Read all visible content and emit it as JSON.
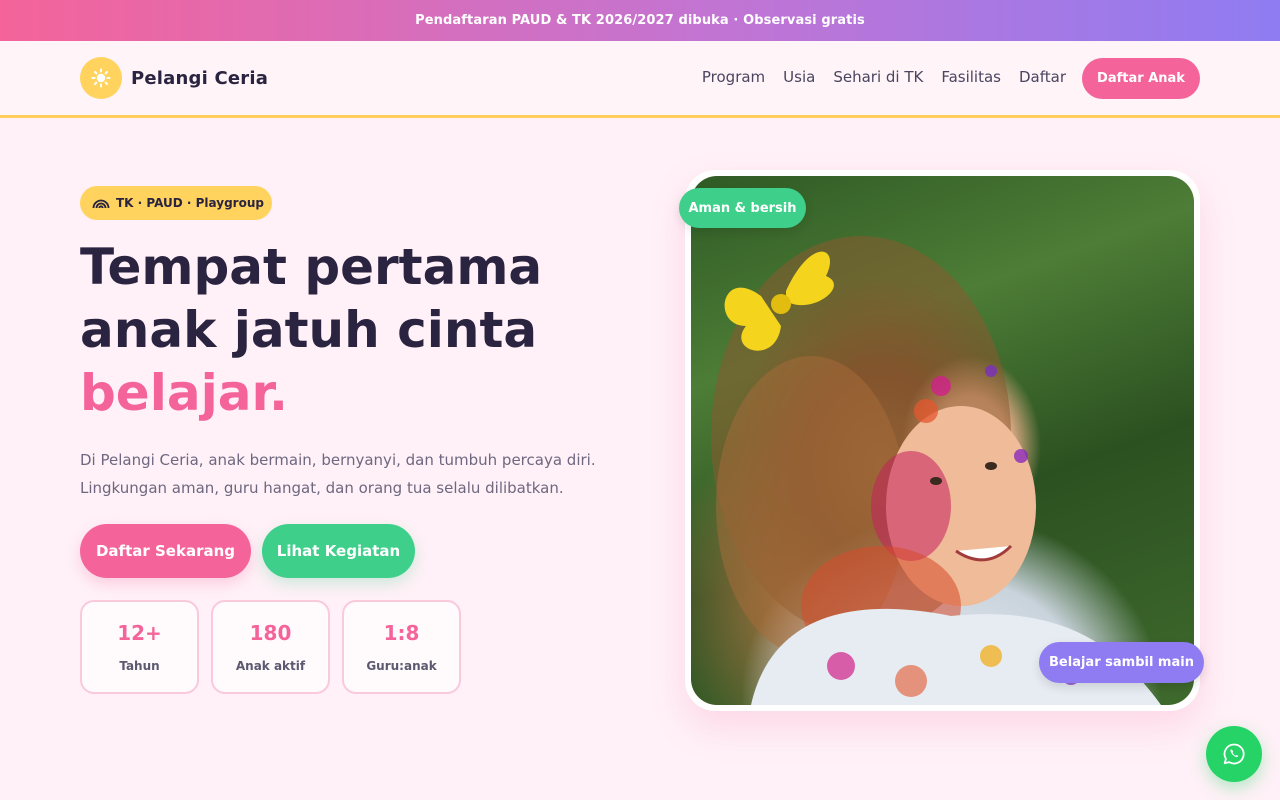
{
  "announcement": {
    "text": "Pendaftaran PAUD & TK 2026/2027 dibuka · Observasi gratis"
  },
  "brand": {
    "name": "Pelangi Ceria",
    "icon": "sun-icon"
  },
  "nav": {
    "links": [
      "Program",
      "Usia",
      "Sehari di TK",
      "Fasilitas",
      "Daftar"
    ],
    "cta_label": "Daftar Anak"
  },
  "hero": {
    "tag": "TK · PAUD · Playgroup",
    "tag_icon": "rainbow-icon",
    "headline_line1": "Tempat pertama",
    "headline_line2": "anak jatuh cinta",
    "headline_accent": "belajar.",
    "lead_line1": "Di Pelangi Ceria, anak bermain, bernyanyi, dan tumbuh percaya diri.",
    "lead_line2": "Lingkungan aman, guru hangat, dan orang tua selalu dilibatkan.",
    "primary_button": "Daftar Sekarang",
    "secondary_button": "Lihat Kegiatan",
    "stats": [
      {
        "value": "12+",
        "label": "Tahun"
      },
      {
        "value": "180",
        "label": "Anak aktif"
      },
      {
        "value": "1:8",
        "label": "Guru:anak"
      }
    ],
    "photo_badge_top": "Aman & bersih",
    "photo_badge_bottom": "Belajar sambil main"
  },
  "floating": {
    "whatsapp_icon": "whatsapp-icon"
  },
  "colors": {
    "pink": "#f4649a",
    "green": "#3ecf8b",
    "yellow": "#ffd35e",
    "purple": "#8f7cf2",
    "whatsapp": "#25d366"
  }
}
